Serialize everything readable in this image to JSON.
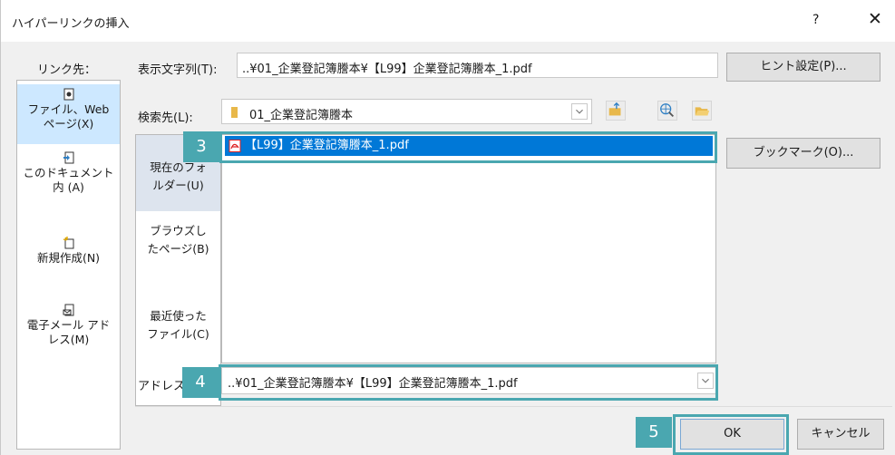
{
  "window": {
    "title": "ハイパーリンクの挿入",
    "help": "?",
    "close": "✕"
  },
  "link_to_label": "リンク先：",
  "nav": [
    {
      "label": "ファイル、Web ページ(X)",
      "icon": "file-icon"
    },
    {
      "label": "このドキュメント内 (A)",
      "icon": "document-icon"
    },
    {
      "label": "新規作成(N)",
      "icon": "new-document-icon"
    },
    {
      "label": "電子メール アドレス(M)",
      "icon": "email-icon"
    }
  ],
  "display_text": {
    "label": "表示文字列(T):",
    "value": "..¥01_企業登記簿謄本¥【L99】企業登記簿謄本_1.pdf"
  },
  "screen_tip_button": "ヒント設定(P)...",
  "look_in": {
    "label": "検索先(L):",
    "value": "01_企業登記簿謄本"
  },
  "bookmark_button": "ブックマーク(O)...",
  "sub_nav": [
    {
      "label": "現在のフォルダー(U)"
    },
    {
      "label": "ブラウズしたページ(B)"
    },
    {
      "label": "最近使ったファイル(C)"
    }
  ],
  "files": [
    {
      "name": "【L99】企業登記簿謄本_1.pdf"
    }
  ],
  "address": {
    "label": "アドレス",
    "value": "..¥01_企業登記簿謄本¥【L99】企業登記簿謄本_1.pdf"
  },
  "ok_button": "OK",
  "cancel_button": "キャンセル",
  "steps": {
    "three": "3",
    "four": "4",
    "five": "5"
  },
  "colors": {
    "accent": "#4aa7b0",
    "selection": "#0078d7"
  }
}
